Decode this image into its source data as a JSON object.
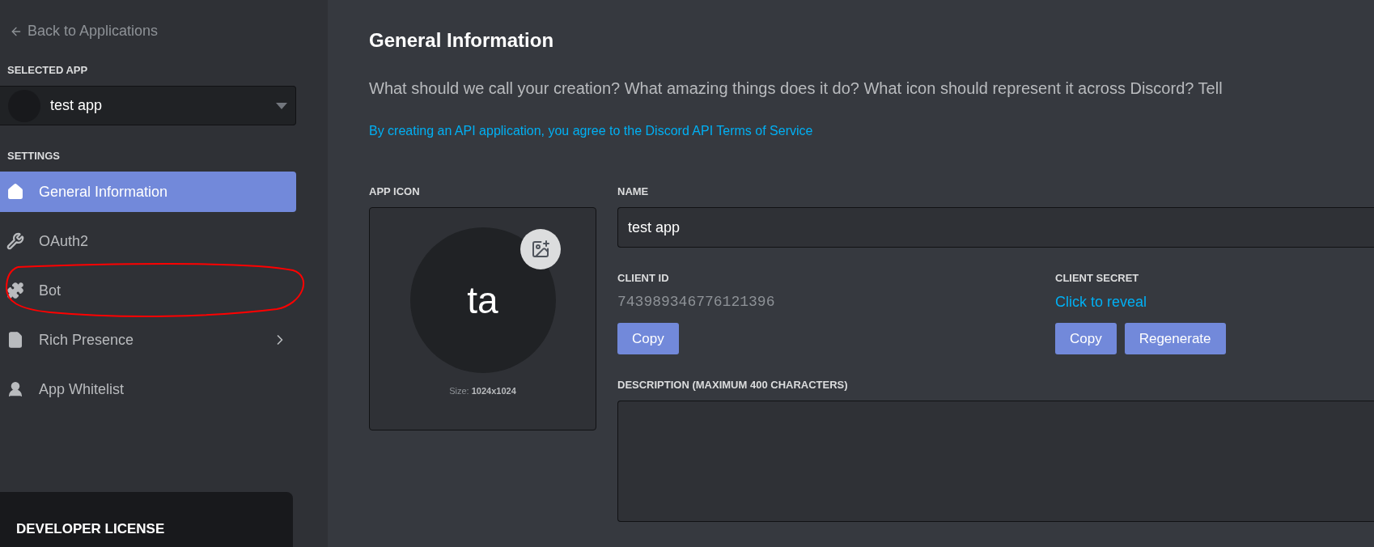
{
  "sidebar": {
    "back_link": "Back to Applications",
    "selected_app_heading": "SELECTED APP",
    "app_select": {
      "value": "test app"
    },
    "settings_heading": "SETTINGS",
    "items": [
      {
        "label": "General Information",
        "kind": "home",
        "selected": true,
        "expandable": false,
        "circled": false
      },
      {
        "label": "OAuth2",
        "kind": "wrench",
        "selected": false,
        "expandable": false,
        "circled": false
      },
      {
        "label": "Bot",
        "kind": "puzzle",
        "selected": false,
        "expandable": false,
        "circled": true
      },
      {
        "label": "Rich Presence",
        "kind": "document",
        "selected": false,
        "expandable": true,
        "circled": false
      },
      {
        "label": "App Whitelist",
        "kind": "person",
        "selected": false,
        "expandable": false,
        "circled": false
      }
    ],
    "developer_license": {
      "title": "DEVELOPER LICENSE"
    }
  },
  "main": {
    "title": "General Information",
    "description": "What should we call your creation? What amazing things does it do? What icon should represent it across Discord? Tell",
    "terms_link": "By creating an API application, you agree to the Discord API Terms of Service",
    "app_icon": {
      "label": "APP ICON",
      "initials": "ta",
      "size_label": "Size: ",
      "size_value": "1024x1024"
    },
    "name": {
      "label": "NAME",
      "value": "test app"
    },
    "client_id": {
      "label": "CLIENT ID",
      "value": "743989346776121396",
      "buttons": [
        "Copy"
      ]
    },
    "client_secret": {
      "label": "CLIENT SECRET",
      "reveal_link": "Click to reveal",
      "buttons": [
        "Copy",
        "Regenerate"
      ]
    },
    "description_field": {
      "label": "DESCRIPTION (MAXIMUM 400 CHARACTERS)"
    }
  }
}
